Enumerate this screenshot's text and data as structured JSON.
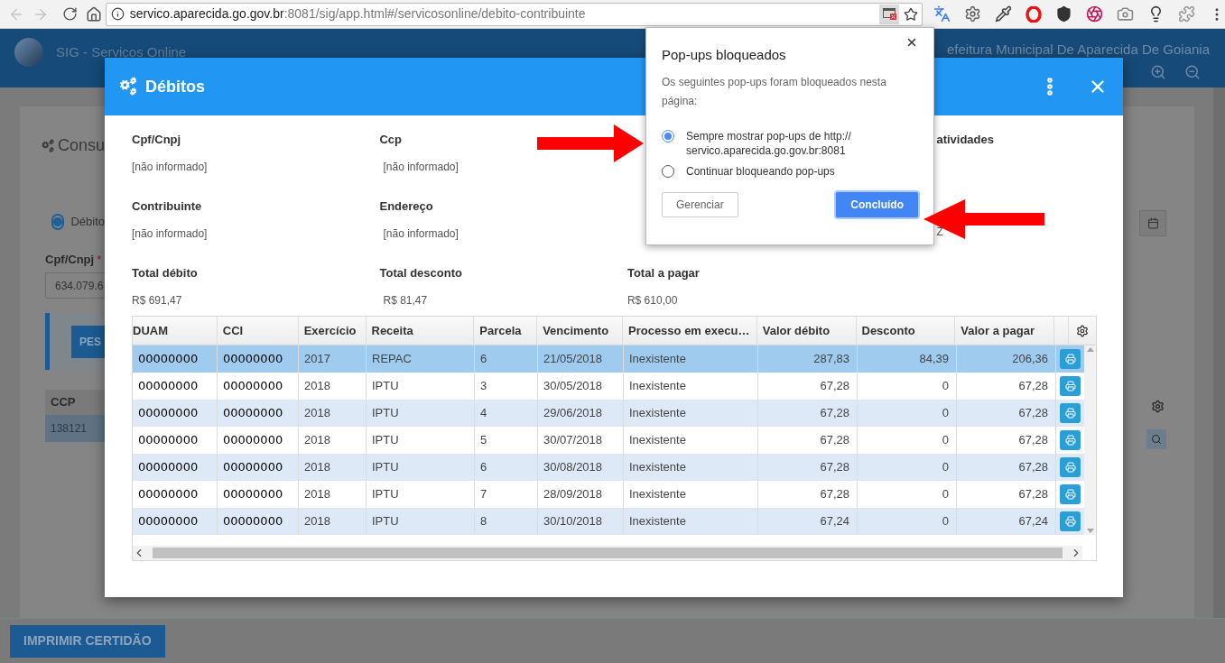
{
  "browser": {
    "url_host": "servico.aparecida.go.gov.br",
    "url_path": ":8081/sig/app.html#/servicosonline/debito-contribuinte"
  },
  "app_header": {
    "title": "SIG - Serviços Online",
    "organization": "efeitura Municipal De Aparecida De Goiania"
  },
  "background": {
    "heading": "Consu",
    "radio": {
      "label": "Débito",
      "selected": true
    },
    "field_label": "Cpf/Cnpj",
    "required_mark": "*",
    "field_value": "634.079.6",
    "search_button": "PES",
    "grid_header": "CCP",
    "grid_cell": "138121",
    "print_button": "IMPRIMIR CERTIDÃO"
  },
  "modal": {
    "title": "Débitos",
    "field_rows": [
      [
        {
          "label": "Cpf/Cnpj",
          "value": "[não informado]"
        },
        {
          "label": "Ccp",
          "value": "[não informado]"
        }
      ],
      [
        {
          "label": "Contribuinte",
          "value": "[não informado]"
        },
        {
          "label": "Endereço",
          "value": "[não informado]"
        }
      ],
      [
        {
          "label": "Total débito",
          "value": "R$ 691,47"
        },
        {
          "label": "Total desconto",
          "value": "R$ 81,47"
        },
        {
          "label": "Total a pagar",
          "value": "R$ 610,00"
        }
      ]
    ],
    "right_column": [
      {
        "label": "atividades"
      },
      {
        "value": "Z"
      }
    ],
    "table": {
      "columns": [
        {
          "label": "DUAM",
          "kind": "code"
        },
        {
          "label": "CCI",
          "kind": "code"
        },
        {
          "label": "Exercício",
          "kind": "text"
        },
        {
          "label": "Receita",
          "kind": "text"
        },
        {
          "label": "Parcela",
          "kind": "text"
        },
        {
          "label": "Vencimento",
          "kind": "text"
        },
        {
          "label": "Processo em execu…",
          "kind": "text"
        },
        {
          "label": "Valor débito",
          "kind": "number"
        },
        {
          "label": "Desconto",
          "kind": "number"
        },
        {
          "label": "Valor a pagar",
          "kind": "number"
        }
      ],
      "rows": [
        {
          "selected": true,
          "cells": [
            "00000000",
            "00000000",
            "2017",
            "REPAC",
            "6",
            "21/05/2018",
            "Inexistente",
            "287,83",
            "84,39",
            "206,36"
          ]
        },
        {
          "selected": false,
          "cells": [
            "00000000",
            "00000000",
            "2018",
            "IPTU",
            "3",
            "30/05/2018",
            "Inexistente",
            "67,28",
            "0",
            "67,28"
          ]
        },
        {
          "selected": false,
          "cells": [
            "00000000",
            "00000000",
            "2018",
            "IPTU",
            "4",
            "29/06/2018",
            "Inexistente",
            "67,28",
            "0",
            "67,28"
          ]
        },
        {
          "selected": false,
          "cells": [
            "00000000",
            "00000000",
            "2018",
            "IPTU",
            "5",
            "30/07/2018",
            "Inexistente",
            "67,28",
            "0",
            "67,28"
          ]
        },
        {
          "selected": false,
          "cells": [
            "00000000",
            "00000000",
            "2018",
            "IPTU",
            "6",
            "30/08/2018",
            "Inexistente",
            "67,28",
            "0",
            "67,28"
          ]
        },
        {
          "selected": false,
          "cells": [
            "00000000",
            "00000000",
            "2018",
            "IPTU",
            "7",
            "28/09/2018",
            "Inexistente",
            "67,28",
            "0",
            "67,28"
          ]
        },
        {
          "selected": false,
          "cells": [
            "00000000",
            "00000000",
            "2018",
            "IPTU",
            "8",
            "30/10/2018",
            "Inexistente",
            "67,24",
            "0",
            "67,24"
          ]
        }
      ]
    }
  },
  "popup": {
    "title": "Pop-ups bloqueados",
    "message": "Os seguintes pop-ups foram bloqueados nesta página:",
    "options": [
      {
        "label": "Sempre mostrar pop-ups de http:// servico.aparecida.go.gov.br:8081",
        "selected": true
      },
      {
        "label": "Continuar bloqueando pop-ups",
        "selected": false
      }
    ],
    "buttons": [
      {
        "label": "Gerenciar",
        "kind": "secondary"
      },
      {
        "label": "Concluído",
        "kind": "primary"
      }
    ]
  }
}
